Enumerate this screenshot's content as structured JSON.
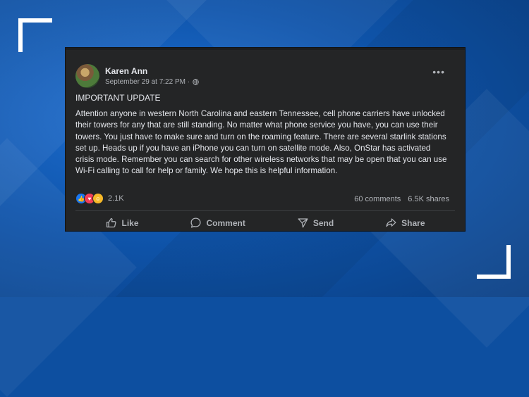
{
  "post": {
    "author": "Karen Ann",
    "timestamp": "September 29 at 7:22 PM · ",
    "headline": "IMPORTANT UPDATE",
    "body": "Attention anyone in western North Carolina and eastern Tennessee, cell phone carriers have unlocked their towers for any that are still standing. No matter what phone service you have, you can use their towers. You just have to make sure and turn on the roaming feature. There are several starlink stations set up. Heads up if you have an iPhone you can turn on satellite mode. Also, OnStar has activated crisis mode. Remember you can search for other wireless networks that may be open that you can use Wi-Fi calling to call for help or family. We hope this is helpful information.",
    "reaction_count": "2.1K",
    "comments": "60 comments",
    "shares": "6.5K shares"
  },
  "actions": {
    "like": "Like",
    "comment": "Comment",
    "send": "Send",
    "share": "Share"
  },
  "icons": [
    "globe-icon",
    "more-options-icon",
    "like-reaction-icon",
    "love-reaction-icon",
    "care-reaction-icon",
    "like-icon",
    "comment-icon",
    "send-icon",
    "share-icon"
  ],
  "colors": {
    "background": "#0d4fa0",
    "card": "#242526",
    "text": "#e4e6eb",
    "muted": "#b0b3b8",
    "like": "#1877f2",
    "love": "#f33e58",
    "care": "#f7b928"
  }
}
